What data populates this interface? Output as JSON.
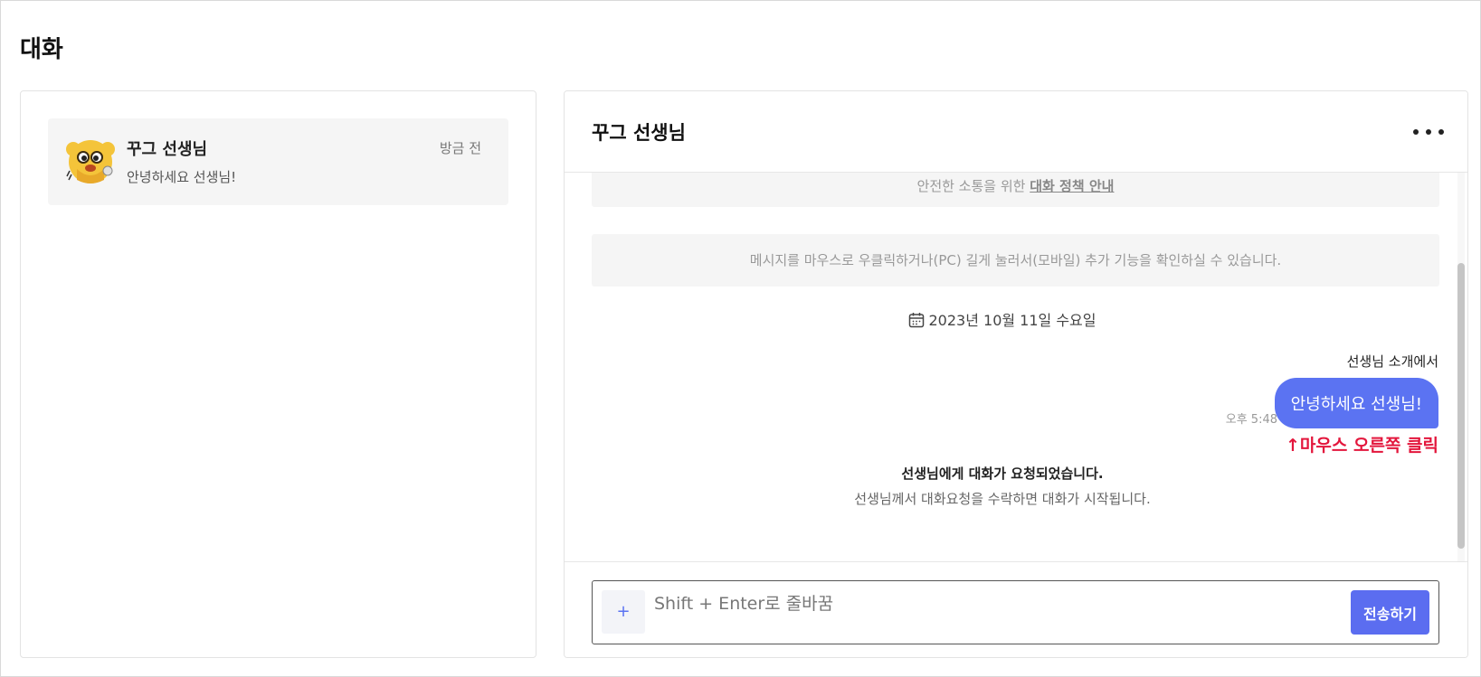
{
  "page": {
    "title": "대화"
  },
  "conversations": [
    {
      "name": "꾸그 선생님",
      "time": "방금 전",
      "preview": "안녕하세요 선생님!",
      "avatar_icon": "cartoon-character-avatar"
    }
  ],
  "chat": {
    "title": "꾸그 선생님",
    "more_icon": "more-horizontal-icon",
    "policy_notice_prefix": "안전한 소통을 위한 ",
    "policy_link": "대화 정책 안내",
    "tip_notice": "메시지를 마우스로 우클릭하거나(PC) 길게 눌러서(모바일) 추가 기능을 확인하실 수 있습니다.",
    "date": "2023년 10월 11일 수요일",
    "date_icon": "calendar-icon",
    "message_source": "선생님 소개에서",
    "message_text": "안녕하세요 선생님!",
    "message_time": "오후 5:48",
    "annotation": "↑마우스 오른쪽 클릭",
    "request_title": "선생님에게 대화가 요청되었습니다.",
    "request_subtitle": "선생님께서 대화요청을 수락하면 대화가 시작됩니다."
  },
  "composer": {
    "plus_label": "+",
    "placeholder": "Shift + Enter로 줄바꿈",
    "value": "",
    "send_label": "전송하기"
  },
  "colors": {
    "accent": "#5b73f2",
    "annotation": "#e3163c",
    "notice_bg": "#f5f5f5"
  }
}
